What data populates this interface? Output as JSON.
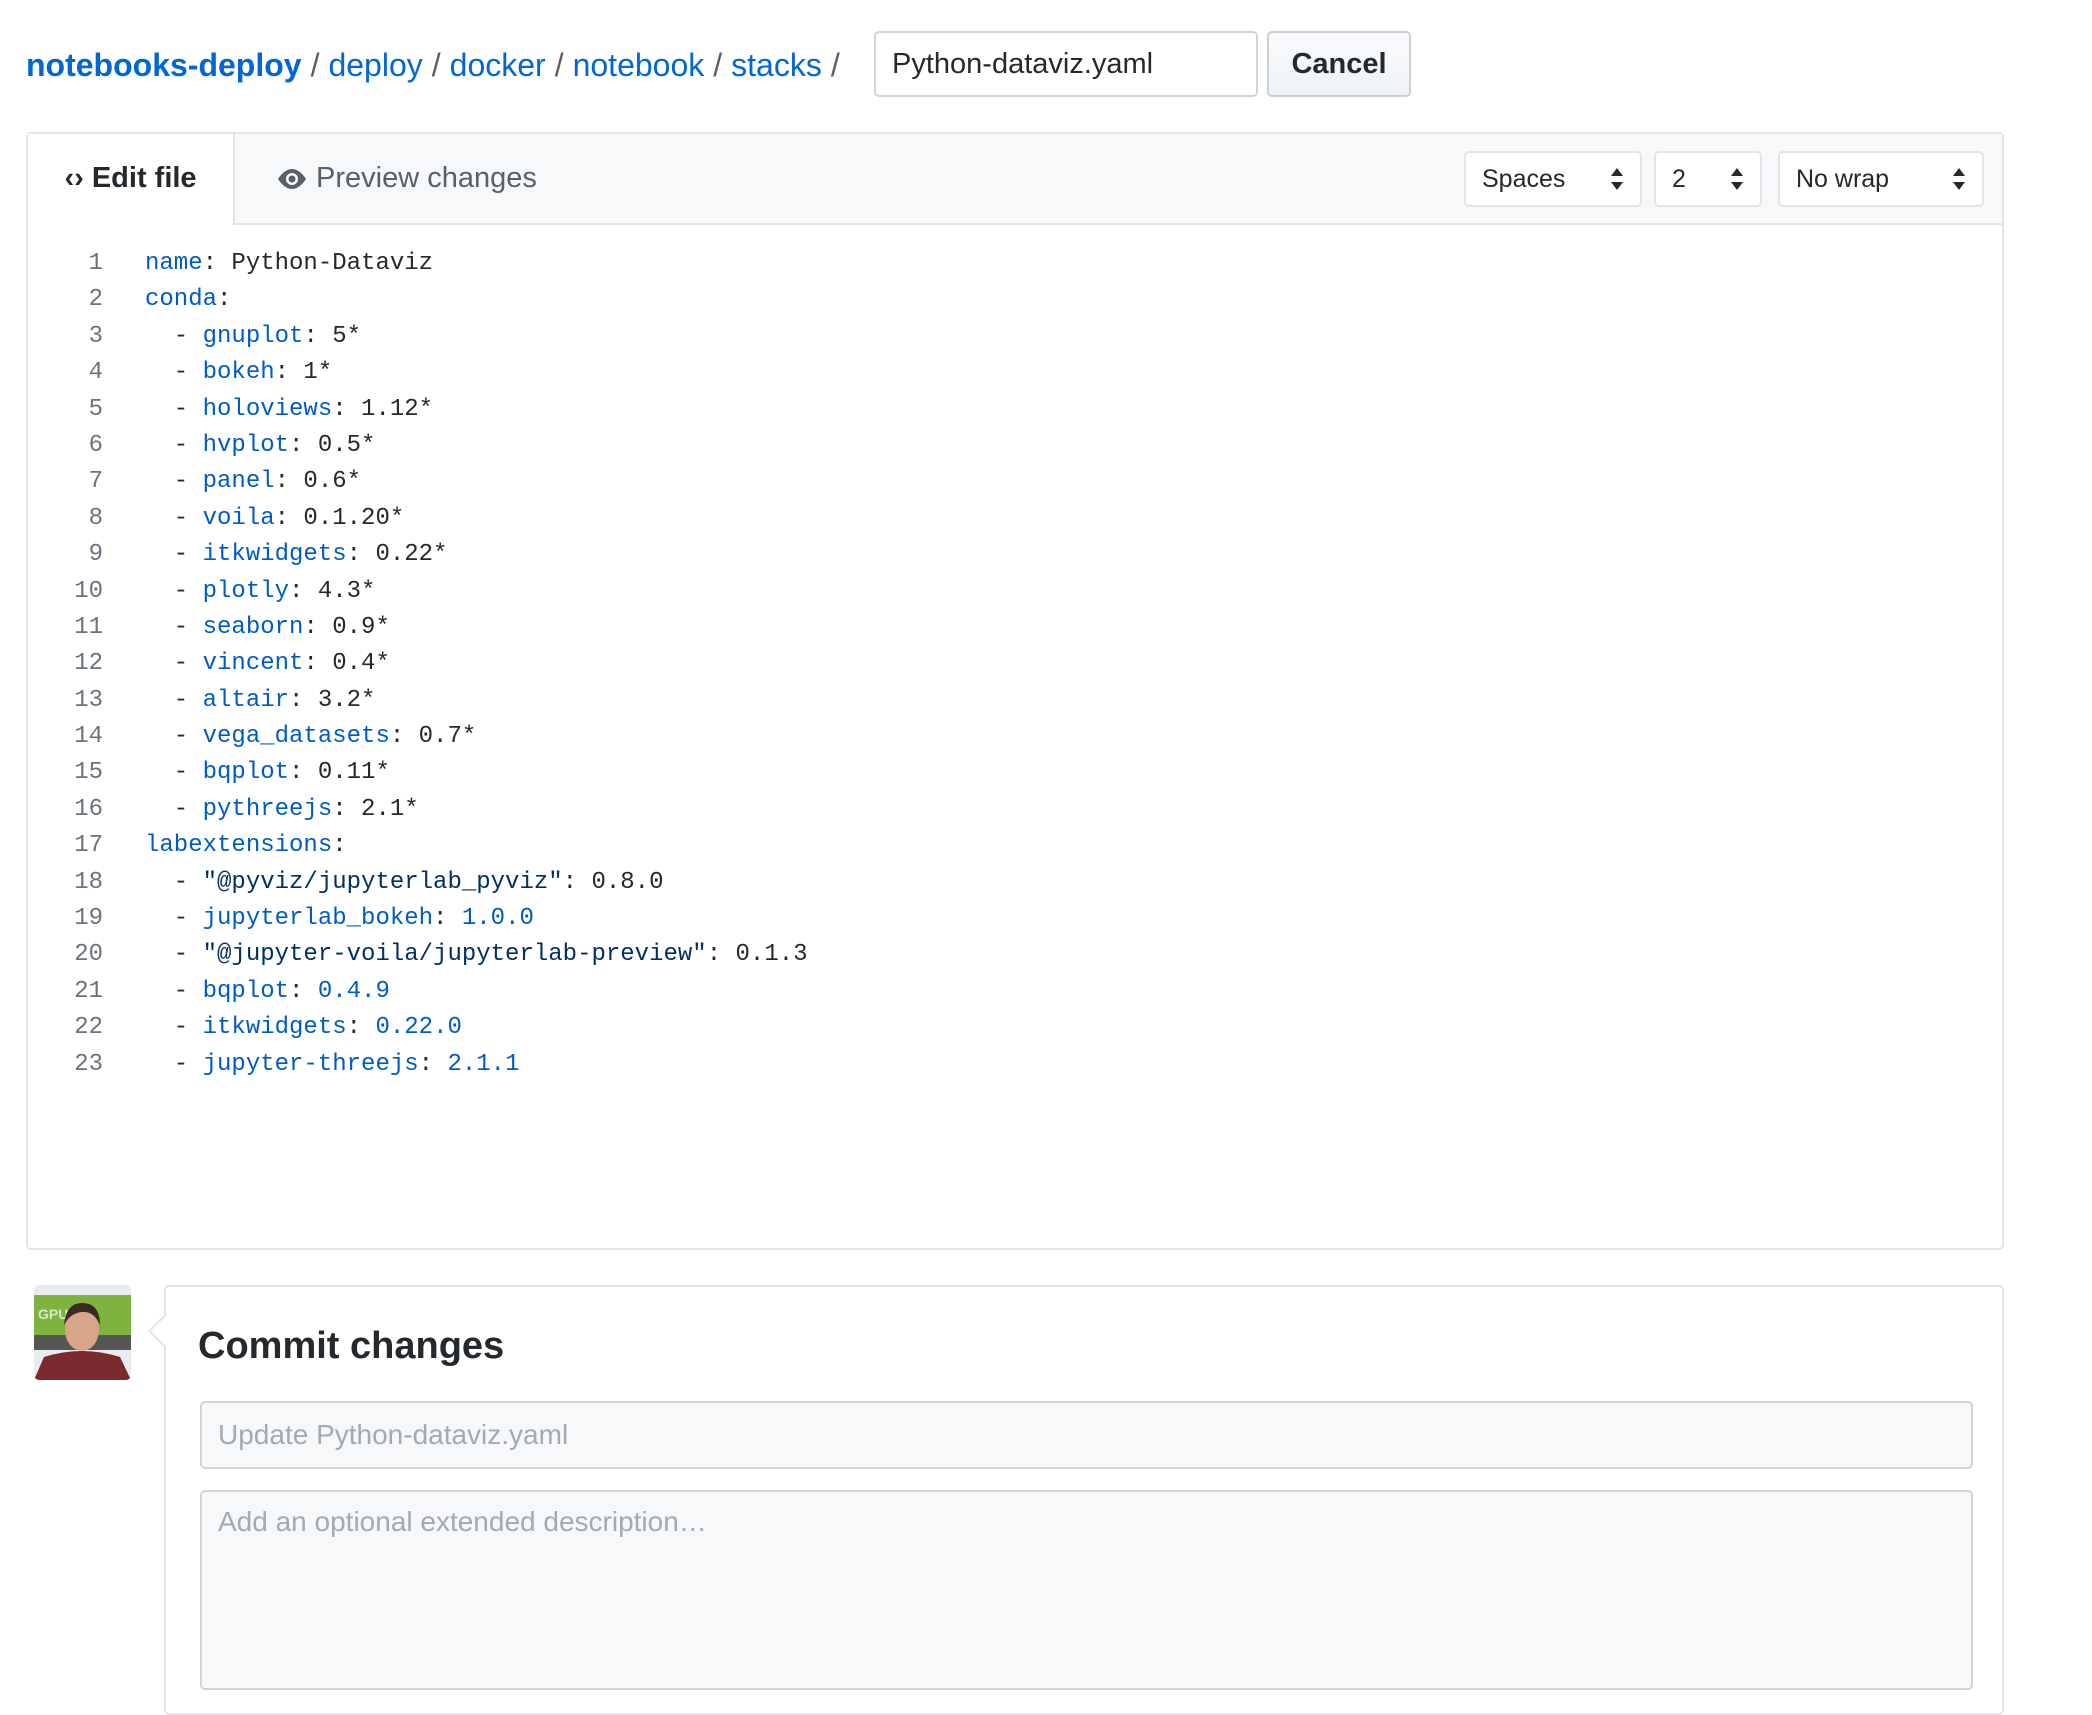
{
  "breadcrumb": {
    "root": "notebooks-deploy",
    "parts": [
      "deploy",
      "docker",
      "notebook",
      "stacks"
    ],
    "separator": "/"
  },
  "filename_input": {
    "value": "Python-dataviz.yaml"
  },
  "cancel_label": "Cancel",
  "editor": {
    "tabs": {
      "edit": "Edit file",
      "preview": "Preview changes"
    },
    "indent_mode": "Spaces",
    "indent_size": "2",
    "wrap_mode": "No wrap",
    "lines": [
      [
        [
          "key",
          "name"
        ],
        [
          "plain",
          ": Python-Dataviz"
        ]
      ],
      [
        [
          "key",
          "conda"
        ],
        [
          "plain",
          ":"
        ]
      ],
      [
        [
          "plain",
          "  - "
        ],
        [
          "key",
          "gnuplot"
        ],
        [
          "plain",
          ": 5*"
        ]
      ],
      [
        [
          "plain",
          "  - "
        ],
        [
          "key",
          "bokeh"
        ],
        [
          "plain",
          ": 1*"
        ]
      ],
      [
        [
          "plain",
          "  - "
        ],
        [
          "key",
          "holoviews"
        ],
        [
          "plain",
          ": 1.12*"
        ]
      ],
      [
        [
          "plain",
          "  - "
        ],
        [
          "key",
          "hvplot"
        ],
        [
          "plain",
          ": 0.5*"
        ]
      ],
      [
        [
          "plain",
          "  - "
        ],
        [
          "key",
          "panel"
        ],
        [
          "plain",
          ": 0.6*"
        ]
      ],
      [
        [
          "plain",
          "  - "
        ],
        [
          "key",
          "voila"
        ],
        [
          "plain",
          ": 0.1.20*"
        ]
      ],
      [
        [
          "plain",
          "  - "
        ],
        [
          "key",
          "itkwidgets"
        ],
        [
          "plain",
          ": 0.22*"
        ]
      ],
      [
        [
          "plain",
          "  - "
        ],
        [
          "key",
          "plotly"
        ],
        [
          "plain",
          ": 4.3*"
        ]
      ],
      [
        [
          "plain",
          "  - "
        ],
        [
          "key",
          "seaborn"
        ],
        [
          "plain",
          ": 0.9*"
        ]
      ],
      [
        [
          "plain",
          "  - "
        ],
        [
          "key",
          "vincent"
        ],
        [
          "plain",
          ": 0.4*"
        ]
      ],
      [
        [
          "plain",
          "  - "
        ],
        [
          "key",
          "altair"
        ],
        [
          "plain",
          ": 3.2*"
        ]
      ],
      [
        [
          "plain",
          "  - "
        ],
        [
          "key",
          "vega_datasets"
        ],
        [
          "plain",
          ": 0.7*"
        ]
      ],
      [
        [
          "plain",
          "  - "
        ],
        [
          "key",
          "bqplot"
        ],
        [
          "plain",
          ": 0.11*"
        ]
      ],
      [
        [
          "plain",
          "  - "
        ],
        [
          "key",
          "pythreejs"
        ],
        [
          "plain",
          ": 2.1*"
        ]
      ],
      [
        [
          "key",
          "labextensions"
        ],
        [
          "plain",
          ":"
        ]
      ],
      [
        [
          "plain",
          "  - "
        ],
        [
          "str",
          "\"@pyviz/jupyterlab_pyviz\""
        ],
        [
          "plain",
          ": 0.8.0"
        ]
      ],
      [
        [
          "plain",
          "  - "
        ],
        [
          "key",
          "jupyterlab_bokeh"
        ],
        [
          "plain",
          ": "
        ],
        [
          "num",
          "1.0.0"
        ]
      ],
      [
        [
          "plain",
          "  - "
        ],
        [
          "str",
          "\"@jupyter-voila/jupyterlab-preview\""
        ],
        [
          "plain",
          ": 0.1.3"
        ]
      ],
      [
        [
          "plain",
          "  - "
        ],
        [
          "key",
          "bqplot"
        ],
        [
          "plain",
          ": "
        ],
        [
          "num",
          "0.4.9"
        ]
      ],
      [
        [
          "plain",
          "  - "
        ],
        [
          "key",
          "itkwidgets"
        ],
        [
          "plain",
          ": "
        ],
        [
          "num",
          "0.22.0"
        ]
      ],
      [
        [
          "plain",
          "  - "
        ],
        [
          "key",
          "jupyter-threejs"
        ],
        [
          "plain",
          ": "
        ],
        [
          "num",
          "2.1.1"
        ]
      ]
    ]
  },
  "commit": {
    "title": "Commit changes",
    "summary_placeholder": "Update Python-dataviz.yaml",
    "description_placeholder": "Add an optional extended description…",
    "avatar_text": "GPU"
  },
  "colors": {
    "link": "#0366d6",
    "key": "#005cc5",
    "string": "#032f62"
  }
}
